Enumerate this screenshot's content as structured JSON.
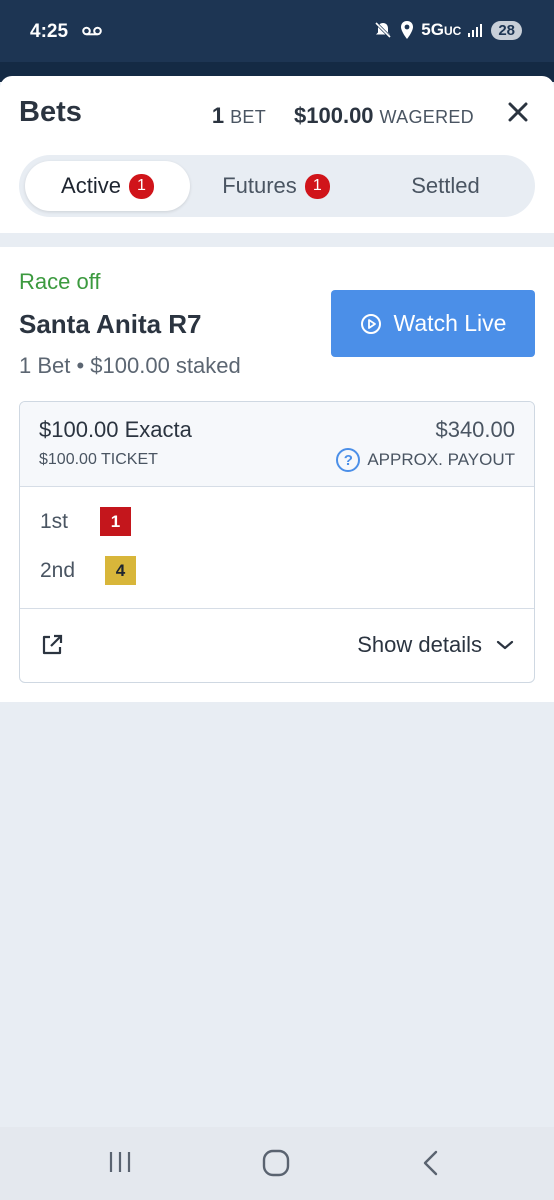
{
  "status_bar": {
    "time": "4:25",
    "network": "5G",
    "network_sub": "UC",
    "battery": "28"
  },
  "header": {
    "title": "Bets",
    "bet_count": "1",
    "bet_label": "BET",
    "wagered_amount": "$100.00",
    "wagered_label": "WAGERED"
  },
  "tabs": [
    {
      "label": "Active",
      "badge": "1",
      "selected": true
    },
    {
      "label": "Futures",
      "badge": "1",
      "selected": false
    },
    {
      "label": "Settled",
      "selected": false
    }
  ],
  "race": {
    "status": "Race off",
    "name": "Santa Anita R7",
    "summary": "1 Bet • $100.00 staked",
    "watch_label": "Watch Live"
  },
  "bet_card": {
    "wager": "$100.00 Exacta",
    "ticket": "$100.00 TICKET",
    "payout": "$340.00",
    "payout_label": "APPROX. PAYOUT",
    "positions": [
      {
        "place": "1st",
        "runner": "1",
        "color": "#c4161c"
      },
      {
        "place": "2nd",
        "runner": "4",
        "color": "#d8b63a"
      }
    ],
    "details_label": "Show details"
  },
  "colors": {
    "accent": "#4b8fe8",
    "status_green": "#3c9a3f",
    "badge_red": "#d0141a",
    "header_navy": "#1d3553"
  }
}
